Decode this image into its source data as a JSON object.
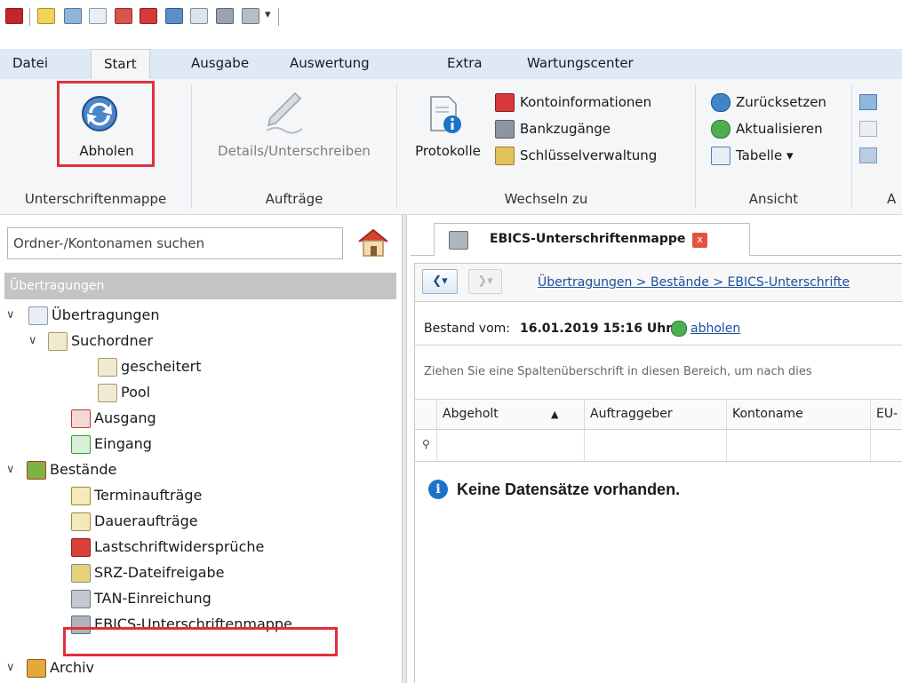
{
  "ribbon_tabs": [
    "Datei",
    "Start",
    "Ausgabe",
    "Auswertung",
    "Extra",
    "Wartungscenter"
  ],
  "ribbon": {
    "groups": {
      "unterschriftenmappe": {
        "label": "Unterschriftenmappe",
        "abholen": "Abholen"
      },
      "auftraege": {
        "label": "Aufträge",
        "details": "Details/Unterschreiben"
      },
      "wechseln_zu": {
        "label": "Wechseln zu",
        "protokolle": "Protokolle",
        "kontoinformationen": "Kontoinformationen",
        "bankzugaenge": "Bankzugänge",
        "schluesselverwaltung": "Schlüsselverwaltung"
      },
      "ansicht": {
        "label": "Ansicht",
        "zuruecksetzen": "Zurücksetzen",
        "aktualisieren": "Aktualisieren",
        "tabelle": "Tabelle ▾"
      },
      "cut_group_label": "A"
    }
  },
  "left": {
    "search_placeholder": "Ordner-/Kontonamen suchen",
    "section_header": "Übertragungen",
    "tree": {
      "uebertragungen": "Übertragungen",
      "suchordner": "Suchordner",
      "gescheitert": "gescheitert",
      "pool": "Pool",
      "ausgang": "Ausgang",
      "eingang": "Eingang",
      "bestaende": "Bestände",
      "terminauftraege": "Terminaufträge",
      "dauerauftraege": "Daueraufträge",
      "lastschriftwidersprueche": "Lastschriftwidersprüche",
      "srz_dateifreigabe": "SRZ-Dateifreigabe",
      "tan_einreichung": "TAN-Einreichung",
      "ebics_unterschriftenmappe": "EBICS-Unterschriftenmappe",
      "archiv": "Archiv"
    }
  },
  "right": {
    "doc_tab": "EBICS-Unterschriftenmappe",
    "close_glyph": "x",
    "breadcrumb": "Übertragungen > Bestände > EBICS-Unterschrifte",
    "stand_label": "Bestand vom:",
    "stand_value": "16.01.2019 15:16 Uhr",
    "abholen_link": "abholen",
    "group_hint": "Ziehen Sie eine Spaltenüberschrift in diesen Bereich, um nach dies",
    "columns": [
      "Abgeholt",
      "Auftraggeber",
      "Kontoname",
      "EU-"
    ],
    "sort_glyph": "▲",
    "no_records": "Keine Datensätze vorhanden."
  },
  "colors": {
    "highlight": "#e0303a",
    "link": "#1a4f9e",
    "tab_bar": "#dfe9f5",
    "section_header": "#c4c4c4"
  }
}
